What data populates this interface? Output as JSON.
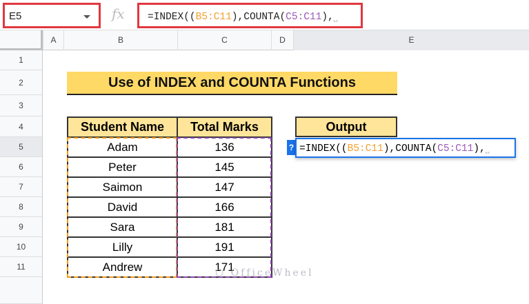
{
  "name_box": {
    "value": "E5"
  },
  "formula_bar": {
    "icon": "fx-icon",
    "prefix": "=INDEX((",
    "ref1": "B5:C11",
    "mid": "),COUNTA(",
    "ref2": "C5:C11",
    "suffix": "),",
    "cursor": "⎵"
  },
  "columns": [
    "A",
    "B",
    "C",
    "D",
    "E"
  ],
  "rows": [
    "1",
    "2",
    "3",
    "4",
    "5",
    "6",
    "7",
    "8",
    "9",
    "10",
    "11"
  ],
  "selected_row": "5",
  "title": "Use of INDEX and COUNTA Functions",
  "table": {
    "headers": [
      "Student Name",
      "Total Marks"
    ],
    "rows": [
      [
        "Adam",
        "136"
      ],
      [
        "Peter",
        "145"
      ],
      [
        "Saimon",
        "147"
      ],
      [
        "David",
        "166"
      ],
      [
        "Sara",
        "181"
      ],
      [
        "Lilly",
        "191"
      ],
      [
        "Andrew",
        "171"
      ]
    ]
  },
  "output": {
    "header": "Output",
    "help": "?"
  },
  "watermark": "OfficeWheel",
  "colors": {
    "highlight_border": "#e0373f",
    "range1": "#f39c12",
    "range2": "#8e44ad",
    "header_fill": "#ffe599",
    "title_fill": "#ffd966",
    "active": "#1a73e8"
  }
}
